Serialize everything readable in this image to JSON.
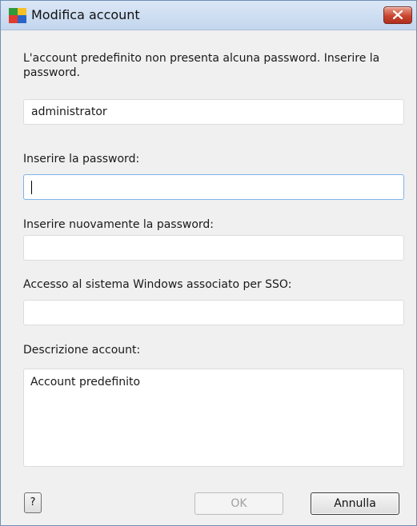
{
  "window": {
    "title": "Modifica account",
    "icon": "avg-logo-icon",
    "close_icon": "close-icon"
  },
  "form": {
    "message": "L'account predefinito non presenta alcuna password. Inserire la password.",
    "username_value": "administrator",
    "password_label": "Inserire la password:",
    "password_value": "",
    "confirm_label": "Inserire nuovamente la password:",
    "confirm_value": "",
    "sso_label": "Accesso al sistema Windows associato per SSO:",
    "sso_value": "",
    "description_label": "Descrizione account:",
    "description_value": "Account predefinito"
  },
  "buttons": {
    "help_label": "?",
    "ok_label": "OK",
    "ok_enabled": false,
    "cancel_label": "Annulla"
  },
  "colors": {
    "titlebar": "#c3d6ee",
    "background": "#f0f0f0",
    "close_button": "#c8462f",
    "focus_border": "#7eb4ea"
  }
}
